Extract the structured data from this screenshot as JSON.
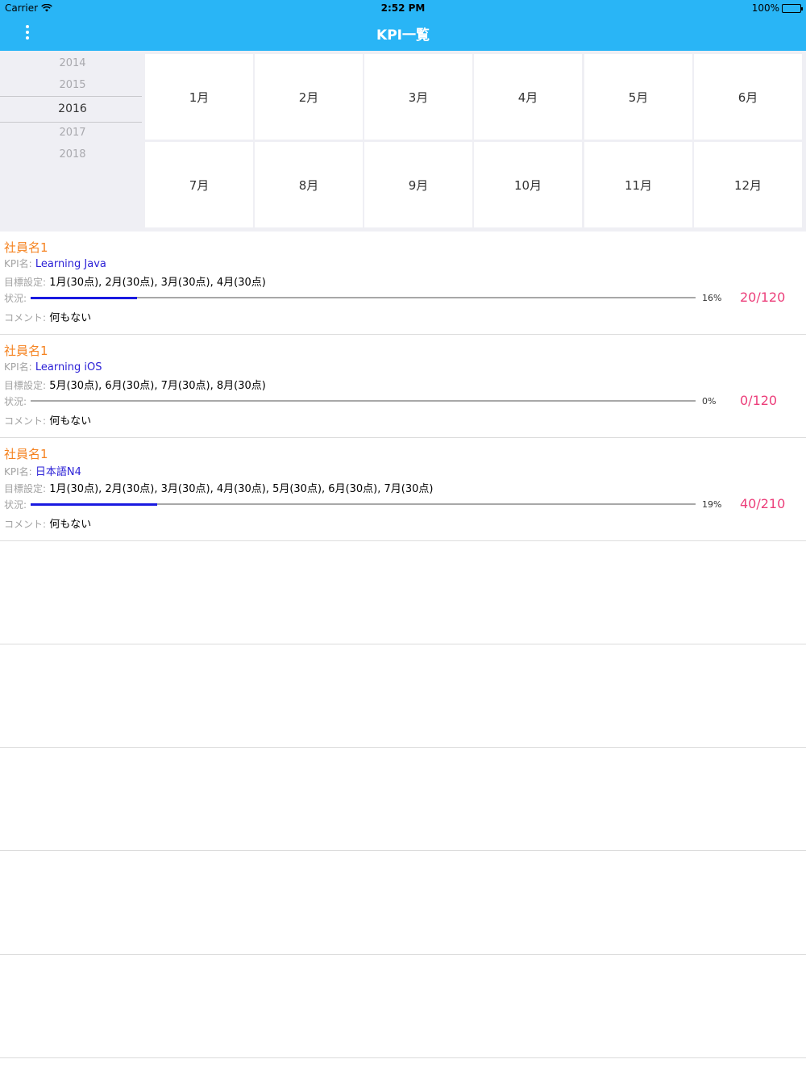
{
  "status_bar": {
    "carrier": "Carrier",
    "time": "2:52 PM",
    "battery": "100%"
  },
  "nav": {
    "title": "KPI一覧",
    "menu_icon": "more-vertical-icon"
  },
  "year_picker": {
    "years": [
      "2014",
      "2015",
      "2016",
      "2017",
      "2018"
    ],
    "selected": "2016"
  },
  "months": [
    "1月",
    "2月",
    "3月",
    "4月",
    "5月",
    "6月",
    "7月",
    "8月",
    "9月",
    "10月",
    "11月",
    "12月"
  ],
  "labels": {
    "kpi": "KPI名:",
    "target": "目標設定:",
    "status": "状況:",
    "comment": "コメント:"
  },
  "items": [
    {
      "employee": "社員名1",
      "kpi_name": "Learning Java",
      "target": "1月(30点), 2月(30点), 3月(30点), 4月(30点)",
      "progress": 0.16,
      "percent": "16%",
      "score": "20/120",
      "comment": "何もない"
    },
    {
      "employee": "社員名1",
      "kpi_name": "Learning iOS",
      "target": "5月(30点), 6月(30点), 7月(30点), 8月(30点)",
      "progress": 0,
      "percent": "0%",
      "score": "0/120",
      "comment": "何もない"
    },
    {
      "employee": "社員名1",
      "kpi_name": "日本語N4",
      "target": "1月(30点), 2月(30点), 3月(30点), 4月(30点), 5月(30点), 6月(30点), 7月(30点)",
      "progress": 0.19,
      "percent": "19%",
      "score": "40/210",
      "comment": "何もない"
    }
  ],
  "colors": {
    "nav_bg": "#29b5f6",
    "employee": "#f5821f",
    "kpi_name": "#2a1fd6",
    "score": "#ec3e7a",
    "progress_bar": "#1a1ae0"
  }
}
